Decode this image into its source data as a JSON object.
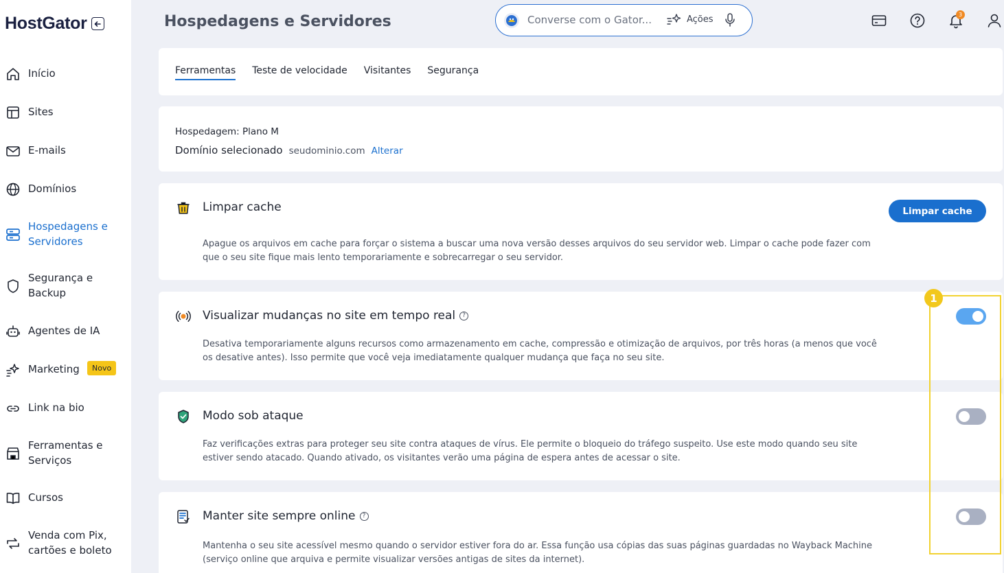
{
  "sidebar": {
    "logo": "HostGator",
    "items": [
      {
        "label": "Início",
        "icon": "home-icon"
      },
      {
        "label": "Sites",
        "icon": "layout-icon"
      },
      {
        "label": "E-mails",
        "icon": "mail-icon"
      },
      {
        "label": "Domínios",
        "icon": "globe-icon"
      },
      {
        "label": "Hospedagens e Servidores",
        "icon": "server-icon",
        "active": true
      },
      {
        "label": "Segurança e Backup",
        "icon": "shield-icon"
      },
      {
        "label": "Agentes de IA",
        "icon": "robot-icon"
      },
      {
        "label": "Marketing",
        "icon": "sparkle-icon",
        "badge": "Novo"
      },
      {
        "label": "Link na bio",
        "icon": "link-icon"
      },
      {
        "label": "Ferramentas e Serviços",
        "icon": "store-icon"
      },
      {
        "label": "Cursos",
        "icon": "book-icon"
      },
      {
        "label": "Venda com Pix, cartões e boleto",
        "icon": "payment-icon"
      }
    ]
  },
  "header": {
    "title": "Hospedagens e Servidores",
    "chat_placeholder": "Converse com o Gator...",
    "chat_actions": "Ações",
    "notification_count": "3"
  },
  "tabs": [
    "Ferramentas",
    "Teste de velocidade",
    "Visitantes",
    "Segurança"
  ],
  "hosting": {
    "plan": "Hospedagem: Plano M",
    "domain_label": "Domínio selecionado",
    "domain_value": "seudominio.com",
    "domain_change": "Alterar"
  },
  "tools": {
    "cache": {
      "title": "Limpar cache",
      "button": "Limpar cache",
      "description": "Apague os arquivos em cache para forçar o sistema a buscar uma nova versão desses arquivos do seu servidor web. Limpar o cache pode fazer com que o seu site fique mais lento temporariamente e sobrecarregar o seu servidor."
    },
    "realtime": {
      "title": "Visualizar mudanças no site em tempo real",
      "description": "Desativa temporariamente alguns recursos como armazenamento em cache, compressão e otimização de arquivos, por três horas (a menos que você os desative antes). Isso permite que você veja imediatamente qualquer mudança que faça no seu site.",
      "enabled": true
    },
    "attack": {
      "title": "Modo sob ataque",
      "description": "Faz verificações extras para proteger seu site contra ataques de vírus. Ele permite o bloqueio do tráfego suspeito. Use este modo quando seu site estiver sendo atacado. Quando ativado, os visitantes verão uma página de espera antes de acessar o site.",
      "enabled": false
    },
    "online": {
      "title": "Manter site sempre online",
      "description": "Mantenha o seu site acessível mesmo quando o servidor estiver fora do ar. Essa função usa cópias das suas páginas guardadas no Wayback Machine (serviço online que arquiva e permite visualizar versões antigas de sites da internet).",
      "enabled": false
    }
  },
  "annotation": {
    "step": "1",
    "color": "#f2d230"
  },
  "colors": {
    "accent": "#1a6fce",
    "toggle_on": "#5aa6f0",
    "toggle_off": "#a9b0c2"
  }
}
